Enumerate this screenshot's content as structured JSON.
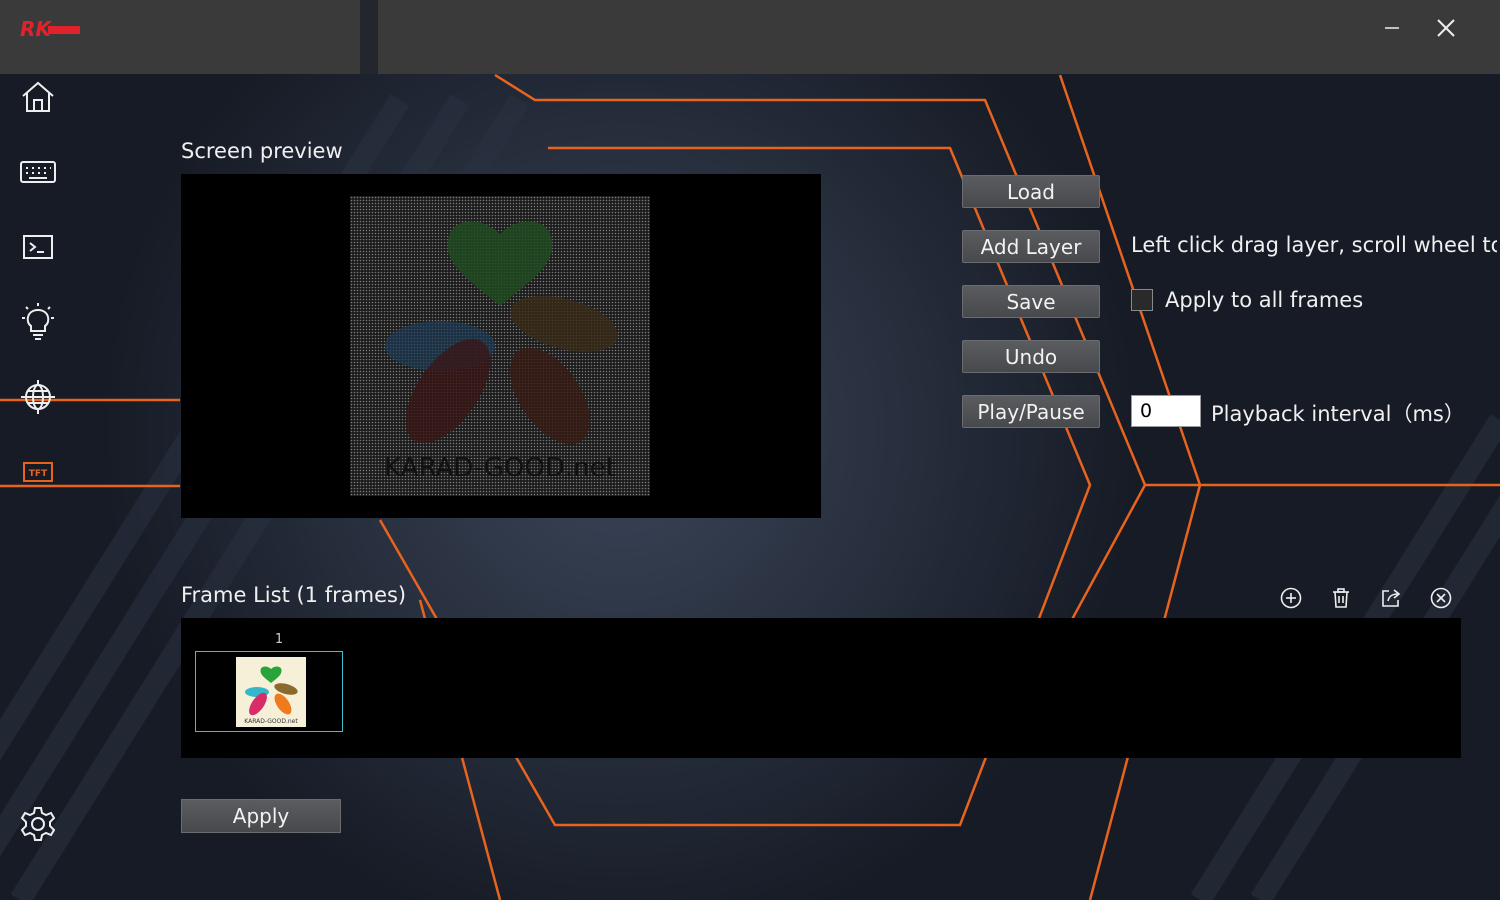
{
  "app": {
    "logo_text": "RK"
  },
  "window": {
    "minimize_icon": "minimize-icon",
    "close_icon": "close-icon"
  },
  "sidebar": {
    "items": [
      {
        "icon": "home-icon"
      },
      {
        "icon": "keyboard-icon"
      },
      {
        "icon": "terminal-icon"
      },
      {
        "icon": "lightbulb-icon"
      },
      {
        "icon": "globe-icon"
      },
      {
        "icon": "tft-icon",
        "text": "TFT",
        "active": true
      }
    ],
    "settings_icon": "gear-icon"
  },
  "preview": {
    "title": "Screen preview",
    "image_caption": "KARAD-GOOD.net"
  },
  "controls": {
    "load_label": "Load",
    "add_layer_label": "Add Layer",
    "save_label": "Save",
    "undo_label": "Undo",
    "play_pause_label": "Play/Pause",
    "hint_text": "Left click drag layer, scroll wheel to...",
    "apply_all_label": "Apply to all frames",
    "apply_all_checked": false,
    "interval_value": "0",
    "interval_label": "Playback interval（ms）"
  },
  "frames": {
    "title": "Frame List  (1 frames)",
    "items": [
      {
        "number": "1",
        "caption": "KARAD-GOOD.net"
      }
    ],
    "tools": [
      "add-icon",
      "trash-icon",
      "export-icon",
      "close-circle-icon"
    ]
  },
  "footer": {
    "apply_label": "Apply"
  },
  "colors": {
    "accent": "#e8641e",
    "highlight": "#3fc1c9",
    "background": "#1d2330"
  }
}
